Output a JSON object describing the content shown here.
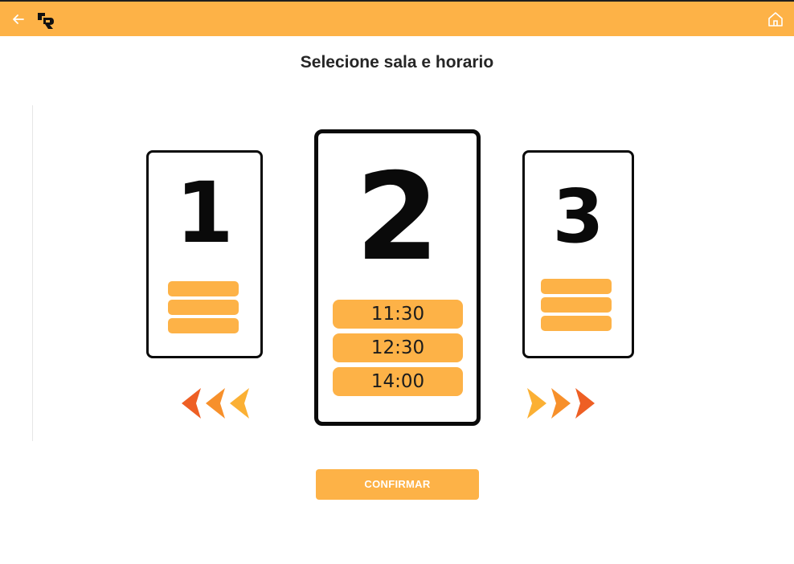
{
  "colors": {
    "accent": "#FDB247",
    "arrow_light": "#F9A52E",
    "arrow_dark": "#EE5F24",
    "card_border": "#0A0A0A"
  },
  "header": {
    "back_icon": "arrow-left-icon",
    "logo_icon": "brand-logo",
    "home_icon": "home-icon"
  },
  "page": {
    "title": "Selecione sala e horario"
  },
  "rooms": [
    {
      "number": "1"
    },
    {
      "number": "2",
      "times": [
        "11:30",
        "12:30",
        "14:00"
      ]
    },
    {
      "number": "3"
    }
  ],
  "nav": {
    "previous_icon": "triple-chevron-left-icon",
    "next_icon": "triple-chevron-right-icon"
  },
  "actions": {
    "confirm_label": "CONFIRMAR"
  }
}
